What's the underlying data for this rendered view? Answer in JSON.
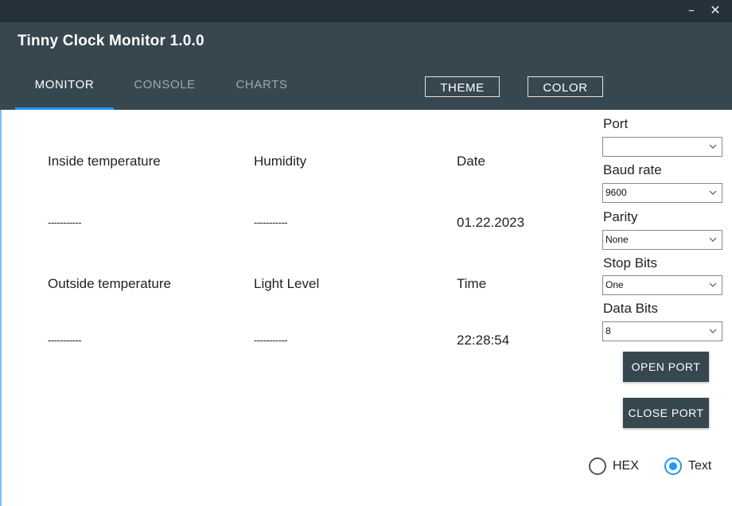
{
  "window": {
    "minimize_glyph": "–",
    "close_glyph": "✕"
  },
  "app": {
    "title": "Tinny Clock Monitor 1.0.0"
  },
  "tabs": [
    {
      "label": "MONITOR",
      "active": true
    },
    {
      "label": "CONSOLE",
      "active": false
    },
    {
      "label": "CHARTS",
      "active": false
    }
  ],
  "header_buttons": {
    "theme": "THEME",
    "color": "COLOR"
  },
  "monitor": {
    "inside_temp_label": "Inside temperature",
    "inside_temp_value": "-----------",
    "humidity_label": "Humidity",
    "humidity_value": "-----------",
    "date_label": "Date",
    "date_value": "01.22.2023",
    "outside_temp_label": "Outside temperature",
    "outside_temp_value": "-----------",
    "light_label": "Light Level",
    "light_value": "-----------",
    "time_label": "Time",
    "time_value": "22:28:54"
  },
  "serial": {
    "port_label": "Port",
    "port_value": "",
    "baud_label": "Baud rate",
    "baud_value": "9600",
    "parity_label": "Parity",
    "parity_value": "None",
    "stop_label": "Stop Bits",
    "stop_value": "One",
    "data_label": "Data Bits",
    "data_value": "8",
    "open_label": "OPEN PORT",
    "close_label": "CLOSE PORT"
  },
  "display_mode": {
    "hex_label": "HEX",
    "text_label": "Text",
    "selected": "Text"
  },
  "colors": {
    "header": "#37474f",
    "titlebar": "#253239",
    "accent": "#2196f3"
  }
}
